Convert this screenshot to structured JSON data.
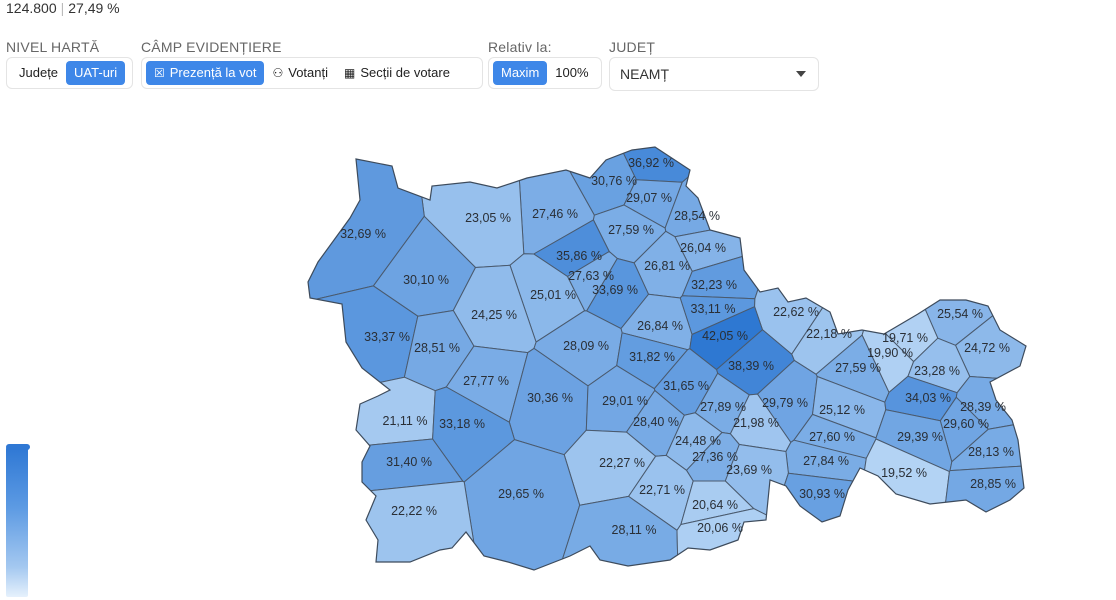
{
  "summary": {
    "count": "124.800",
    "percent": "27,49 %"
  },
  "controls": {
    "map_level": {
      "label": "NIVEL HARTĂ",
      "options": [
        "Județe",
        "UAT-uri"
      ],
      "active": "UAT-uri"
    },
    "highlight_field": {
      "label": "CÂMP EVIDENȚIERE",
      "options": [
        "Prezență la vot",
        "Votanți",
        "Secții de votare"
      ],
      "active": "Prezență la vot"
    },
    "relative_to": {
      "label": "Relativ la:",
      "options": [
        "Maxim",
        "100%"
      ],
      "active": "Maxim"
    },
    "county": {
      "label": "JUDEȚ",
      "value": "NEAMȚ"
    }
  },
  "map": {
    "title": "",
    "colors": {
      "min": "#b3d3f4",
      "max": "#2e78d2",
      "stroke": "#4a5a6e"
    },
    "value_range": [
      19.52,
      42.05
    ],
    "regions": [
      {
        "label": "36,92 %",
        "value": 36.92
      },
      {
        "label": "30,76 %",
        "value": 30.76
      },
      {
        "label": "29,07 %",
        "value": 29.07
      },
      {
        "label": "28,54 %",
        "value": 28.54
      },
      {
        "label": "27,46 %",
        "value": 27.46
      },
      {
        "label": "23,05 %",
        "value": 23.05
      },
      {
        "label": "32,69 %",
        "value": 32.69
      },
      {
        "label": "27,59 %",
        "value": 27.59
      },
      {
        "label": "26,04 %",
        "value": 26.04
      },
      {
        "label": "35,86 %",
        "value": 35.86
      },
      {
        "label": "27,63 %",
        "value": 27.63
      },
      {
        "label": "26,81 %",
        "value": 26.81
      },
      {
        "label": "30,10 %",
        "value": 30.1
      },
      {
        "label": "25,01 %",
        "value": 25.01
      },
      {
        "label": "33,69 %",
        "value": 33.69
      },
      {
        "label": "32,23 %",
        "value": 32.23
      },
      {
        "label": "24,25 %",
        "value": 24.25
      },
      {
        "label": "33,11 %",
        "value": 33.11
      },
      {
        "label": "22,62 %",
        "value": 22.62
      },
      {
        "label": "25,54 %",
        "value": 25.54
      },
      {
        "label": "33,37 %",
        "value": 33.37
      },
      {
        "label": "26,84 %",
        "value": 26.84
      },
      {
        "label": "42,05 %",
        "value": 42.05
      },
      {
        "label": "22,18 %",
        "value": 22.18
      },
      {
        "label": "19,71 %",
        "value": 19.71
      },
      {
        "label": "24,72 %",
        "value": 24.72
      },
      {
        "label": "28,51 %",
        "value": 28.51
      },
      {
        "label": "28,09 %",
        "value": 28.09
      },
      {
        "label": "31,82 %",
        "value": 31.82
      },
      {
        "label": "19,90 %",
        "value": 19.9
      },
      {
        "label": "38,39 %",
        "value": 38.39
      },
      {
        "label": "27,59 %",
        "value": 27.59
      },
      {
        "label": "27,77 %",
        "value": 27.77
      },
      {
        "label": "23,28 %",
        "value": 23.28
      },
      {
        "label": "31,65 %",
        "value": 31.65
      },
      {
        "label": "30,36 %",
        "value": 30.36
      },
      {
        "label": "29,01 %",
        "value": 29.01
      },
      {
        "label": "27,89 %",
        "value": 27.89
      },
      {
        "label": "29,79 %",
        "value": 29.79
      },
      {
        "label": "25,12 %",
        "value": 25.12
      },
      {
        "label": "34,03 %",
        "value": 34.03
      },
      {
        "label": "28,39 %",
        "value": 28.39
      },
      {
        "label": "21,11 %",
        "value": 21.11
      },
      {
        "label": "33,18 %",
        "value": 33.18
      },
      {
        "label": "28,40 %",
        "value": 28.4
      },
      {
        "label": "21,98 %",
        "value": 21.98
      },
      {
        "label": "27,60 %",
        "value": 27.6
      },
      {
        "label": "29,60 %",
        "value": 29.6
      },
      {
        "label": "24,48 %",
        "value": 24.48
      },
      {
        "label": "29,39 %",
        "value": 29.39
      },
      {
        "label": "31,40 %",
        "value": 31.4
      },
      {
        "label": "22,27 %",
        "value": 22.27
      },
      {
        "label": "27,36 %",
        "value": 27.36
      },
      {
        "label": "27,84 %",
        "value": 27.84
      },
      {
        "label": "28,13 %",
        "value": 28.13
      },
      {
        "label": "23,69 %",
        "value": 23.69
      },
      {
        "label": "19,52 %",
        "value": 19.52
      },
      {
        "label": "29,65 %",
        "value": 29.65
      },
      {
        "label": "22,71 %",
        "value": 22.71
      },
      {
        "label": "22,22 %",
        "value": 22.22
      },
      {
        "label": "30,93 %",
        "value": 30.93
      },
      {
        "label": "28,85 %",
        "value": 28.85
      },
      {
        "label": "20,64 %",
        "value": 20.64
      },
      {
        "label": "28,11 %",
        "value": 28.11
      },
      {
        "label": "20,06 %",
        "value": 20.06
      }
    ]
  }
}
